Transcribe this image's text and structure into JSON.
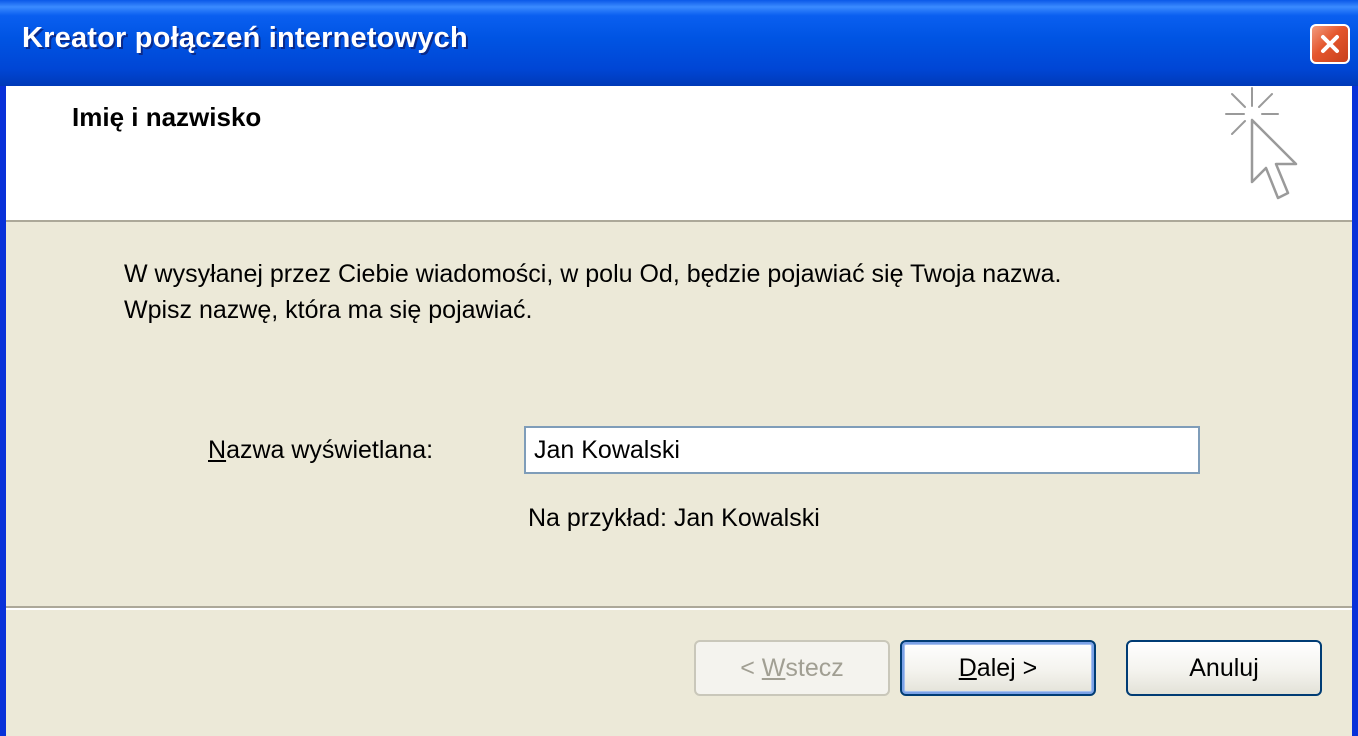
{
  "window": {
    "title": "Kreator połączeń internetowych"
  },
  "header": {
    "title": "Imię i nazwisko",
    "icon": "wizard-cursor-icon"
  },
  "content": {
    "description_line1": "W wysyłanej przez Ciebie wiadomości, w polu Od, będzie pojawiać się Twoja nazwa.",
    "description_line2": "Wpisz nazwę, która ma się pojawiać.",
    "field_label_accel": "N",
    "field_label_rest": "azwa wyświetlana:",
    "display_name_value": "Jan Kowalski",
    "example_text": "Na przykład: Jan Kowalski"
  },
  "buttons": {
    "back_prefix": "< ",
    "back_accel": "W",
    "back_rest": "stecz",
    "next_accel": "D",
    "next_rest": "alej >",
    "cancel_label": "Anuluj"
  },
  "colors": {
    "titlebar": "#0054e3",
    "dialog_bg": "#ece9d8",
    "close_button": "#e4562c"
  }
}
